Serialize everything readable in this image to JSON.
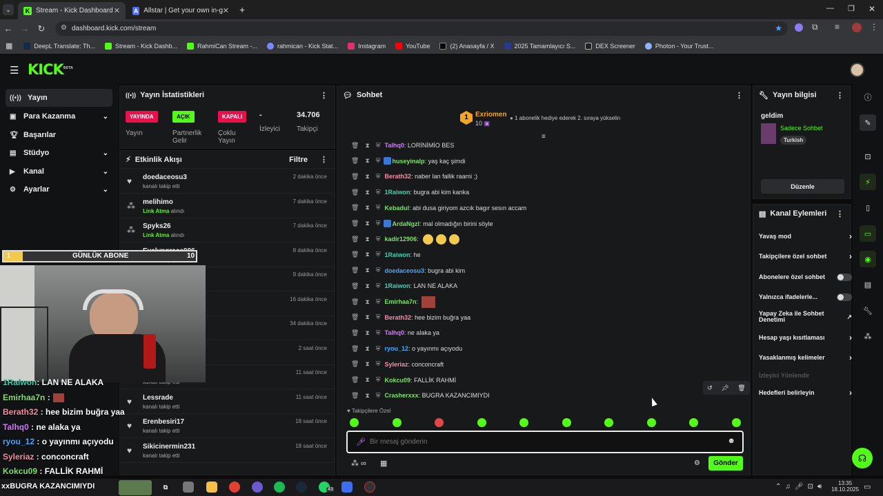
{
  "browser": {
    "tabs": [
      {
        "title": "Stream - Kick Dashboard",
        "active": true
      },
      {
        "title": "Allstar | Get your own in-game",
        "active": false
      }
    ],
    "url": "dashboard.kick.com/stream",
    "bookmarks": [
      "DeepL Translate: Th...",
      "Stream - Kick Dashb...",
      "RahmiCan Stream -...",
      "rahmican - Kick Stat...",
      "Instagram",
      "YouTube",
      "(2) Anasayfa / X",
      "2025 Tamamlayıcı S...",
      "DEX Screener",
      "Photon - Your Trust..."
    ]
  },
  "header": {
    "logo": "KICK",
    "logo_sup": "BETA"
  },
  "sidebar": {
    "items": [
      {
        "label": "Yayın",
        "icon": "broadcast-icon",
        "active": true
      },
      {
        "label": "Para Kazanma",
        "icon": "money-icon",
        "chevron": true
      },
      {
        "label": "Başarılar",
        "icon": "trophy-icon"
      },
      {
        "label": "Stüdyo",
        "icon": "studio-icon",
        "chevron": true
      },
      {
        "label": "Kanal",
        "icon": "channel-icon",
        "chevron": true
      },
      {
        "label": "Ayarlar",
        "icon": "gear-icon",
        "chevron": true
      }
    ]
  },
  "stats": {
    "title": "Yayın İstatistikleri",
    "items": [
      {
        "badge": "YAYINDA",
        "label": "Yayın"
      },
      {
        "badge": "AÇIK",
        "label": "Partnerlik Gelir"
      },
      {
        "badge": "KAPALI",
        "label": "Çoklu Yayın"
      },
      {
        "value": "-",
        "label": "İzleyici"
      },
      {
        "value": "34.706",
        "label": "Takipçi"
      }
    ]
  },
  "activity": {
    "title": "Etkinlik Akışı",
    "filter": "Filtre",
    "rows": [
      {
        "name": "doedaceosu3",
        "sub": "kanalı takip etti",
        "time": "2 dakika önce",
        "icon": "heart-icon"
      },
      {
        "name": "melihimo",
        "sub_hl": "Link Atma",
        "sub": "alındı",
        "time": "7 dakika önce",
        "icon": "redeem-icon"
      },
      {
        "name": "Spyks26",
        "sub_hl": "Link Atma",
        "sub": "alındı",
        "time": "7 dakika önce",
        "icon": "redeem-icon"
      },
      {
        "name": "Evelyngrace006",
        "sub": "kanalı takip etti",
        "time": "8 dakika önce",
        "icon": "heart-icon"
      },
      {
        "name": "",
        "sub": "",
        "time": "9 dakika önce",
        "icon": ""
      },
      {
        "name": "",
        "sub": "",
        "time": "16 dakika önce",
        "icon": ""
      },
      {
        "name": "",
        "sub": "",
        "time": "34 dakika önce",
        "icon": ""
      },
      {
        "name": "",
        "sub": "",
        "time": "2 saat önce",
        "icon": ""
      },
      {
        "name": "",
        "sub": "kanalı takip etti",
        "time": "11 saat önce",
        "icon": ""
      },
      {
        "name": "Lessrade",
        "sub": "kanalı takip etti",
        "time": "11 saat önce",
        "icon": "heart-icon"
      },
      {
        "name": "Erenbesiri17",
        "sub": "kanalı takip etti",
        "time": "18 saat önce",
        "icon": "heart-icon"
      },
      {
        "name": "Sikicinermin231",
        "sub": "kanalı takip etti",
        "time": "18 saat önce",
        "icon": "heart-icon"
      }
    ]
  },
  "chat": {
    "title": "Sohbet",
    "pinned": {
      "rank": "1",
      "user": "Exriomen",
      "count": "10",
      "text": "1 abonelik hediye ederek 2. sıraya yükselin"
    },
    "messages": [
      {
        "user": "Talhq0",
        "color": "#d17cf6",
        "text": "LORİNİMİO BES"
      },
      {
        "user": "huseyinalp",
        "color": "#7ee16b",
        "text": "yaş kaç şimdi"
      },
      {
        "user": "Berath32",
        "color": "#f28fa5",
        "text": "naber lan fallik raami ;)"
      },
      {
        "user": "1Raiwon",
        "color": "#3cd3b3",
        "text": "bugra abi kim kanka"
      },
      {
        "user": "Kebadul",
        "color": "#7ee16b",
        "text": "abi dusa giriyom azcık bagır sesın accam"
      },
      {
        "user": "ArdaNgzl",
        "color": "#7ee16b",
        "text": "mal olmadığın birini söyle"
      },
      {
        "user": "kadir12906",
        "color": "#7ee16b",
        "text": ""
      },
      {
        "user": "1Raiwon",
        "color": "#3cd3b3",
        "text": "he"
      },
      {
        "user": "doedaceosu3",
        "color": "#4aa8ff",
        "text": "bugra abi kim"
      },
      {
        "user": "1Raiwon",
        "color": "#3cd3b3",
        "text": "LAN NE ALAKA"
      },
      {
        "user": "Emirhaa7n",
        "color": "#7ee16b",
        "text": ""
      },
      {
        "user": "Berath32",
        "color": "#f28fa5",
        "text": "hee bizim buğra yaa"
      },
      {
        "user": "Talhq0",
        "color": "#d17cf6",
        "text": "ne alaka ya"
      },
      {
        "user": "ryou_12",
        "color": "#4aa8ff",
        "text": "o yayınmı açıyodu"
      },
      {
        "user": "Syleriaz",
        "color": "#f28fa5",
        "text": "conconcraft"
      },
      {
        "user": "Kokcu09",
        "color": "#7ee16b",
        "text": "FALLİK RAHMİ"
      },
      {
        "user": "Crasherxxx",
        "color": "#7ee16b",
        "text": "BUGRA KAZANCIMIYDI"
      }
    ],
    "followers_only": "Takipçilere Özel",
    "placeholder": "Bir mesaj gönderin",
    "send": "Gönder"
  },
  "stream_info": {
    "title": "Yayın bilgisi",
    "stream_title": "geldim",
    "category": "Sadece Sohbet",
    "language": "Turkish",
    "edit": "Düzenle"
  },
  "channel_actions": {
    "title": "Kanal Eylemleri",
    "items": [
      {
        "label": "Yavaş mod",
        "type": "chevron"
      },
      {
        "label": "Takipçilere özel sohbet",
        "type": "chevron"
      },
      {
        "label": "Abonelere özel sohbet",
        "type": "toggle"
      },
      {
        "label": "Yalnızca ifadelerle...",
        "type": "toggle"
      },
      {
        "label": "Yapay Zeka ile Sohbet Denetimi",
        "type": "external"
      },
      {
        "label": "Hesap yaşı kısıtlaması",
        "type": "chevron"
      },
      {
        "label": "Yasaklanmış kelimeler",
        "type": "chevron"
      },
      {
        "label": "İzleyici Yönlendir",
        "type": "disabled"
      },
      {
        "label": "Hedefleri belirleyin",
        "type": "chevron"
      }
    ]
  },
  "overlay": {
    "sub_label": "GÜNLÜK ABONE",
    "sub_count": "1",
    "sub_total": "10",
    "chat_lines": [
      {
        "user": "1Raiwon",
        "text": ": LAN NE ALAKA",
        "color": "#3cd3b3"
      },
      {
        "user": "Emirhaa7n",
        "text": " :",
        "color": "#7ee16b"
      },
      {
        "user": "Berath32",
        "text": " : hee bizim buğra yaa",
        "color": "#f28fa5"
      },
      {
        "user": "Talhq0",
        "text": " : ne alaka ya",
        "color": "#d17cf6"
      },
      {
        "user": "ryou_12",
        "text": " : o yayınmı açıyodu",
        "color": "#4aa8ff"
      },
      {
        "user": "Syleriaz",
        "text": " : conconcraft",
        "color": "#f28fa5"
      },
      {
        "user": "Kokcu09",
        "text": " : FALLİK RAHMİ",
        "color": "#7ee16b"
      }
    ],
    "bottom_line": "BUGRA KAZANCIMIYDI"
  },
  "taskbar": {
    "time": "13:35",
    "date": "18.10.2025",
    "whatsapp_badge": "43"
  },
  "colors": {
    "accent": "#53fc18",
    "live": "#e9114c"
  }
}
